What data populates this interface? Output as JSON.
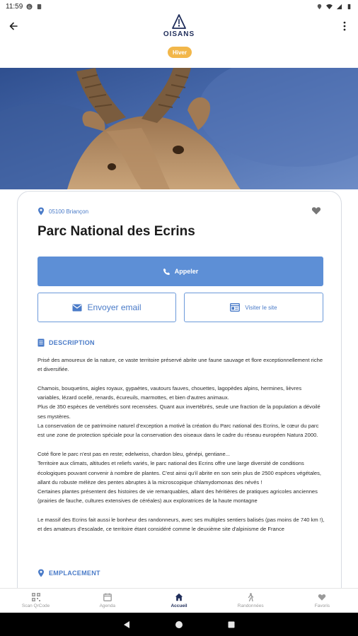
{
  "status_bar": {
    "time": "11:59"
  },
  "header": {
    "logo_text": "OISANS"
  },
  "badge": {
    "season": "Hiver"
  },
  "place": {
    "location": "05100 Briançon",
    "title": "Parc National des Ecrins"
  },
  "actions": {
    "call_label": "Appeler",
    "email_label": "Envoyer email",
    "site_label": "Visiter le site"
  },
  "sections": {
    "description_title": "DESCRIPTION",
    "location_title": "EMPLACEMENT"
  },
  "description": {
    "p1": "Prisé des amoureux de la nature, ce vaste territoire préservé abrite une faune sauvage et flore exceptionnellement riche et diversifiée.",
    "p2": "Chamois, bouquetins, aigles royaux, gypaètes, vautours fauves, chouettes, lagopèdes alpins, hermines, lièvres variables, lézard ocellé, renards, écureuils, marmottes, et bien d'autres animaux.",
    "p3": "Plus de 350 espèces de vertébrés sont recensées. Quant aux invertébrés, seule une fraction de la population a dévoilé ses mystères.",
    "p4": "La conservation de ce patrimoine naturel d'exception a motivé la création du Parc national des Ecrins, le cœur du parc est une zone de protection spéciale pour la conservation des oiseaux dans le cadre du réseau européen Natura 2000.",
    "p5": "Coté flore le parc n'est pas en reste; edelweiss, chardon bleu, génépi, gentiane...",
    "p6": "Territoire aux climats, altitudes et reliefs variés, le parc national des Ecrins offre une large diversité de conditions écologiques pouvant convenir à nombre de plantes. C'est ainsi qu'il abrite en son sein plus de 2500 espèces végétales, allant du robuste mélèze des pentes abruptes à la microscopique chlamydomonas des névés !",
    "p7": "Certaines plantes présentent des histoires de vie remarquables, allant des héritières de pratiques agricoles anciennes (prairies de fauche, cultures extensives de céréales) aux exploratrices de la haute montagne",
    "p8": "Le massif des Ecrins fait aussi le bonheur des randonneurs, avec ses multiples sentiers balisés (pas moins de 740 km !), et des amateurs d'escalade, ce territoire étant considéré comme le deuxième site d'alpinisme de France"
  },
  "bottom_nav": {
    "items": [
      {
        "label": "Scan QrCode",
        "icon": "qrcode-icon"
      },
      {
        "label": "Agenda",
        "icon": "calendar-icon"
      },
      {
        "label": "Accueil",
        "icon": "home-icon"
      },
      {
        "label": "Randonnées",
        "icon": "hiker-icon"
      },
      {
        "label": "Favoris",
        "icon": "heart-icon"
      }
    ],
    "active_index": 2
  },
  "colors": {
    "accent": "#5d8fd6",
    "link": "#4a7bc8",
    "badge": "#f2b74a",
    "logo": "#1f2d5a"
  }
}
